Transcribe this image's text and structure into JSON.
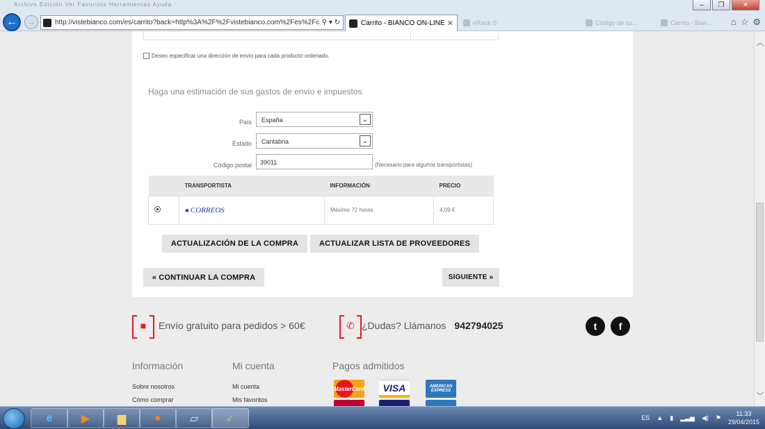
{
  "browser": {
    "menu_faded": "Archivo  Edición  Ver  Favoritos  Herramientas  Ayuda",
    "url": "http://vistebianco.com/es/carrito?back=http%3A%2F%2Fvistebianco.com%2Fes%2Fcar",
    "address_tools": "⚲ ▾ ↻",
    "active_tab_label": "Carrito - BIANCO ON-LINE",
    "ghost_tabs": [
      "eRank S",
      "Código de cu...",
      "Carrito - Bian..."
    ],
    "chrome_icons": [
      "⌂",
      "☆",
      "⚙"
    ]
  },
  "page": {
    "checkbox_label": "Deseo especificar una dirección de envío para cada producto ordenado.",
    "estimate_title": "Haga una estimación de sus gastos de envío e impuestos",
    "fields": {
      "country_label": "País",
      "country_value": "España",
      "state_label": "Estado",
      "state_value": "Cantabria",
      "zip_label": "Código postal",
      "zip_value": "39011",
      "zip_hint": "(Necesario para algunos transportistas)"
    },
    "carrier_table": {
      "headers": [
        "TRANSPORTISTA",
        "INFORMACIÓN",
        "PRECIO"
      ],
      "row": {
        "carrier": "CORREOS",
        "info": "Máximo 72 horas",
        "price": "4,09 €"
      }
    },
    "buttons": {
      "update_cart": "ACTUALIZACIÓN DE LA COMPRA",
      "update_carriers": "ACTUALIZAR LISTA DE PROVEEDORES",
      "continue": "« CONTINUAR LA COMPRA",
      "next": "SIGUIENTE »"
    }
  },
  "footer": {
    "free_shipping": "Envío gratuito para pedidos > 60€",
    "questions": "¿Dudas? Llámanos",
    "phone": "942794025",
    "social": [
      "t",
      "f"
    ],
    "columns": [
      {
        "heading": "Información",
        "links": [
          "Sobre nosotros",
          "Cómo comprar"
        ]
      },
      {
        "heading": "Mi cuenta",
        "links": [
          "Mi cuenta",
          "Mis favoritos"
        ]
      },
      {
        "heading": "Pagos admitidos",
        "links": []
      }
    ],
    "cards": [
      "MasterCard",
      "VISA",
      "AMERICAN EXPRESS"
    ]
  },
  "taskbar": {
    "language": "ES",
    "time": "11:33",
    "date": "29/04/2015"
  },
  "colors": {
    "accent_red": "#e11c24",
    "correos_blue": "#1e3f99"
  }
}
